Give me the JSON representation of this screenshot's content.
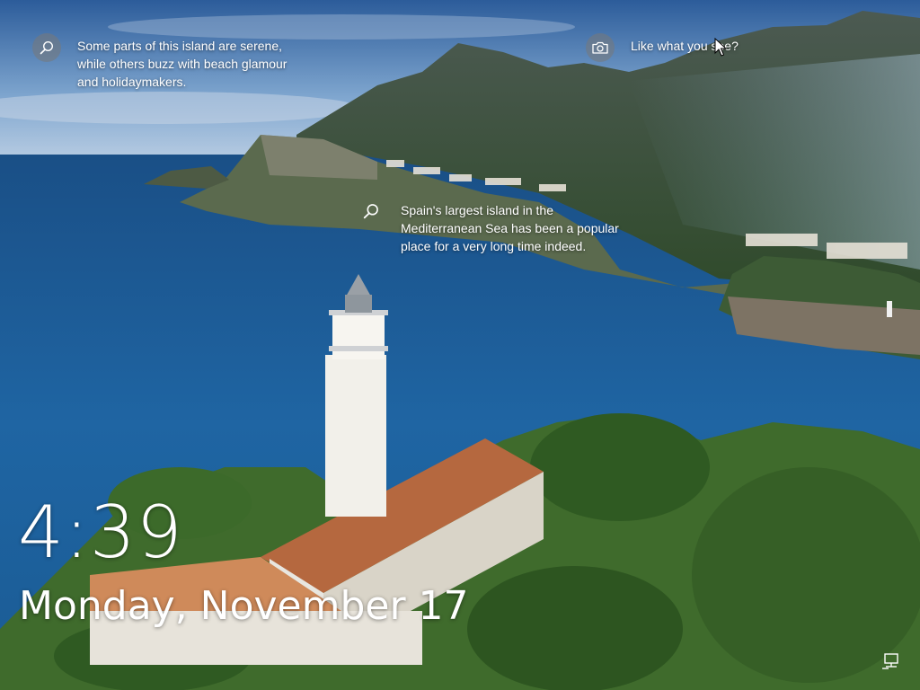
{
  "spotlight": {
    "hotspot_top_left": {
      "icon": "search-icon",
      "text": "Some parts of this island are serene,\nwhile others buzz with beach glamour\nand holidaymakers."
    },
    "hotspot_camera": {
      "icon": "camera-icon",
      "text": "Like what you see?"
    },
    "hotspot_center": {
      "icon": "search-icon",
      "text": "Spain's largest island in the\nMediterranean Sea has been a popular\nplace for a very long time indeed."
    }
  },
  "lockscreen": {
    "time": "4:39",
    "date": "Monday, November 17"
  },
  "status": {
    "network_icon": "network-wired-icon"
  },
  "colors": {
    "sky_top": "#2e5d9b",
    "sea": "#1d5d96",
    "text": "#ffffff"
  }
}
